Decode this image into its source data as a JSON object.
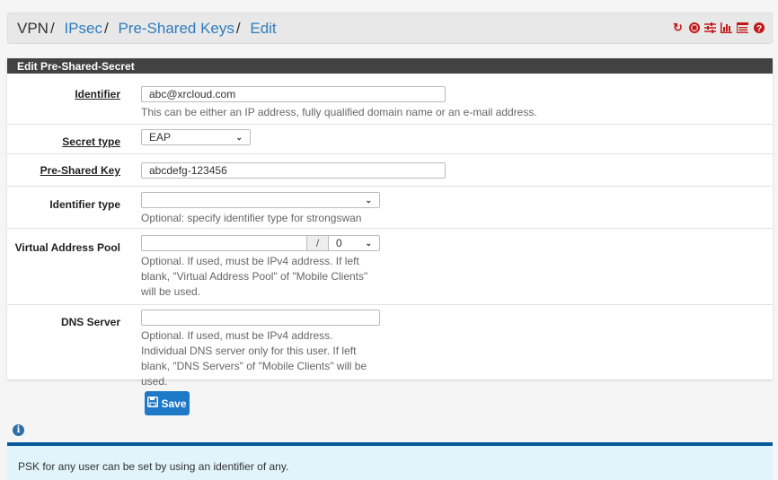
{
  "breadcrumb": [
    {
      "label": "VPN",
      "link": false
    },
    {
      "label": "IPsec",
      "link": true
    },
    {
      "label": "Pre-Shared Keys",
      "link": true
    },
    {
      "label": "Edit",
      "link": true
    }
  ],
  "toolbar_icons": [
    "reload-icon",
    "stop-icon",
    "sliders-icon",
    "bar-chart-icon",
    "log-icon",
    "help-icon"
  ],
  "accent": "#c41717",
  "panel": {
    "title": "Edit Pre-Shared-Secret"
  },
  "form": {
    "identifier": {
      "label": "Identifier",
      "value": "abc@xrcloud.com",
      "help": "This can be either an IP address, fully qualified domain name or an e-mail address."
    },
    "secret_type": {
      "label": "Secret type",
      "value": "EAP"
    },
    "psk": {
      "label": "Pre-Shared Key",
      "value": "abcdefg-123456"
    },
    "identifier_type": {
      "label": "Identifier type",
      "value": "",
      "help": "Optional: specify identifier type for strongswan"
    },
    "vap": {
      "label": "Virtual Address Pool",
      "value": "",
      "slash": "/",
      "mask": "0",
      "help": "Optional. If used, must be IPv4 address. If left blank, \"Virtual Address Pool\" of \"Mobile Clients\" will be used."
    },
    "dns": {
      "label": "DNS Server",
      "value": "",
      "help": "Optional. If used, must be IPv4 address. Individual DNS server only for this user. If left blank, \"DNS Servers\" of \"Mobile Clients\" will be used."
    }
  },
  "save_label": "Save",
  "info_text": "PSK for any user can be set by using an identifier of any."
}
